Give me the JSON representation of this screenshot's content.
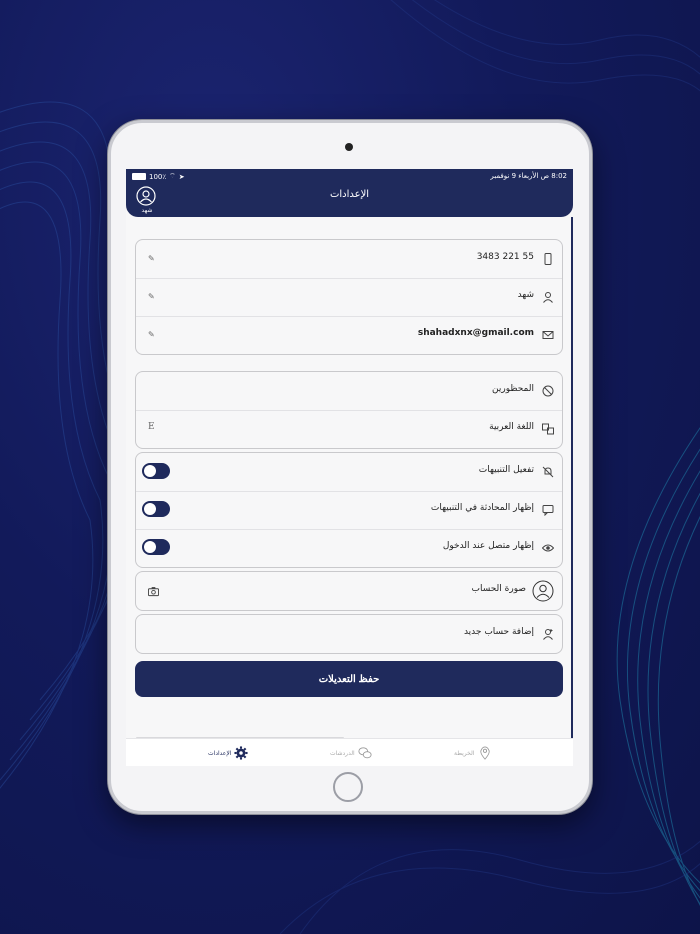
{
  "status_bar": {
    "time_date": "8:02 ص  الأربعاء 9 نوفمبر",
    "battery": "100٪"
  },
  "header": {
    "title": "الإعدادات",
    "user_name": "شهد"
  },
  "profile": {
    "phone": "55 221 3483",
    "name": "شهد",
    "email": "shahadxnx@gmail.com",
    "edit_glyph": "✎"
  },
  "general": {
    "blocked_label": "المحظورين",
    "language_label": "اللغة العربية",
    "language_badge": "E"
  },
  "toggles": {
    "enable_notifications": "تفعيل التنبيهات",
    "show_chat_in_notifications": "إظهار المحادثة في التنبيهات",
    "show_online": "إظهار متصل عند الدخول"
  },
  "account_photo_label": "صورة الحساب",
  "add_account_label": "إضافة حساب جديد",
  "save_button": "حفظ التعديلات",
  "tabs": {
    "settings": "الإعدادات",
    "chats": "الدردشات",
    "map": "الخريطة"
  },
  "colors": {
    "primary": "#1f2a5c",
    "background": "#121a5a"
  }
}
